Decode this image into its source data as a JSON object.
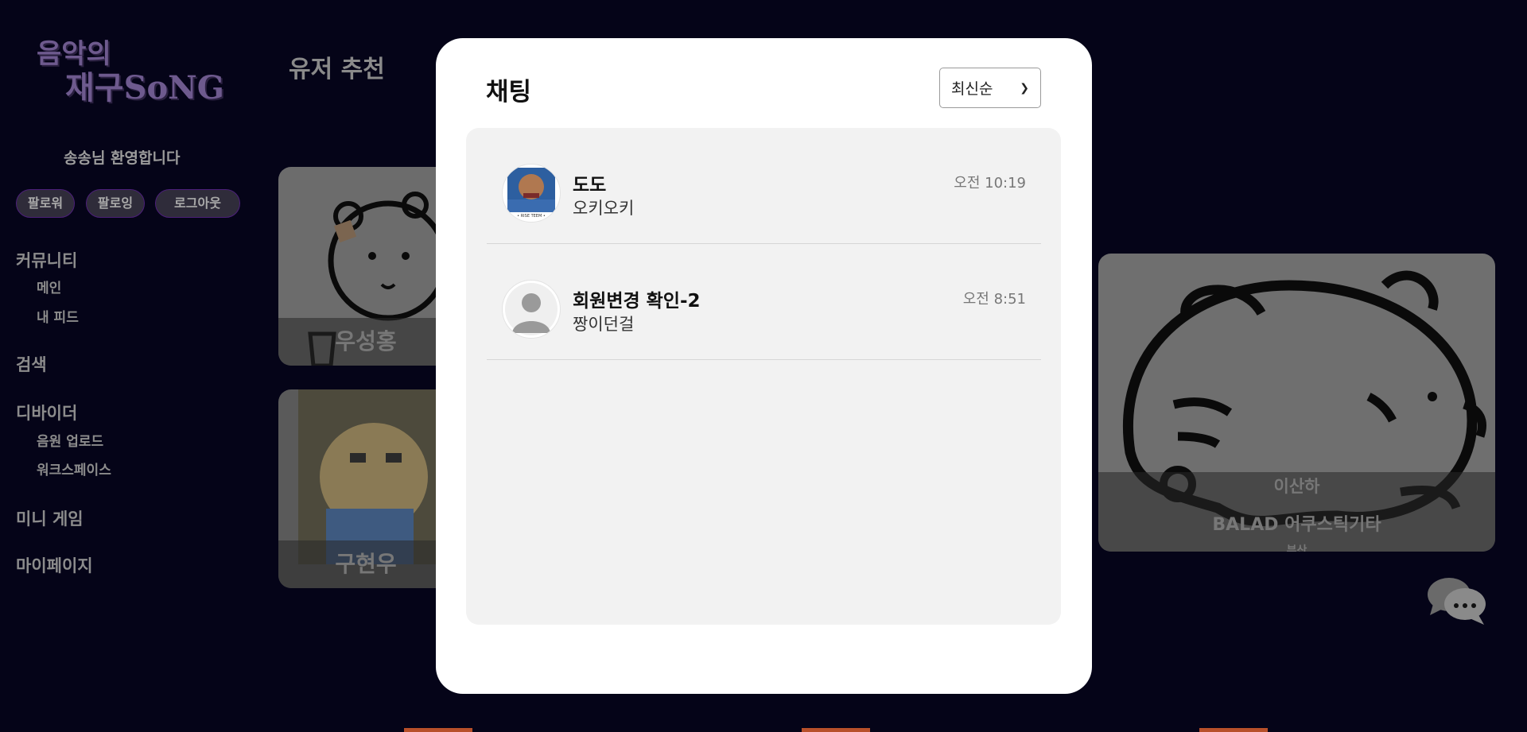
{
  "sidebar": {
    "logo_line1": "음악의",
    "logo_line2": "재구SoNG",
    "welcome": "송송님 환영합니다",
    "buttons": {
      "followers": "팔로워",
      "following": "팔로잉",
      "logout": "로그아웃"
    },
    "nav": {
      "community": "커뮤니티",
      "main": "메인",
      "my_feed": "내 피드",
      "search": "검색",
      "divider": "디바이더",
      "upload": "음원 업로드",
      "workspace": "워크스페이스",
      "mini_game": "미니 게임",
      "mypage": "마이페이지"
    }
  },
  "page": {
    "title": "유저 추천"
  },
  "cards": [
    {
      "name": "우성홍"
    },
    {
      "name": "구현우"
    },
    {
      "name": "이산하",
      "genre": "BALAD 어쿠스틱기타",
      "region": "부산"
    }
  ],
  "chat_modal": {
    "title": "채팅",
    "sort_selected": "최신순",
    "chats": [
      {
        "name": "도도",
        "message": "오키오키",
        "time": "오전 10:19",
        "avatar_caption": "• RISE TEEM •"
      },
      {
        "name": "회원변경 확인-2",
        "message": "짱이던걸",
        "time": "오전 8:51"
      }
    ]
  },
  "fab": {
    "icon": "chat-bubbles-icon"
  }
}
